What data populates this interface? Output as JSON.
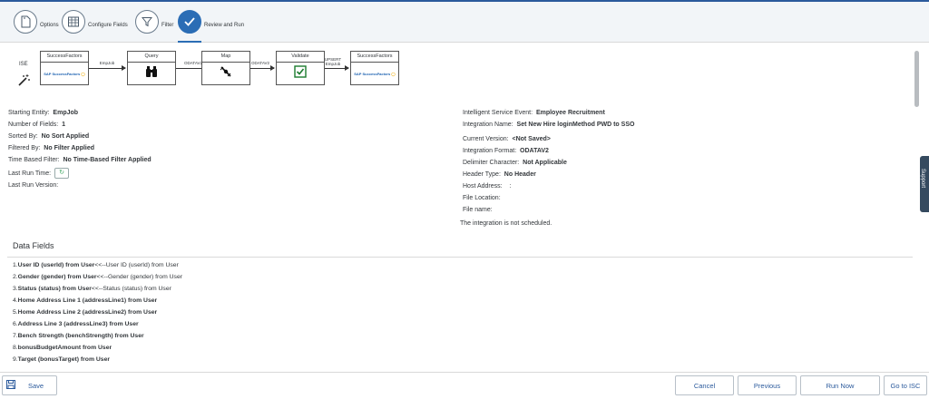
{
  "wizard": {
    "steps": [
      {
        "label": "Options",
        "icon": "document-icon"
      },
      {
        "label": "Configure Fields",
        "icon": "grid-icon"
      },
      {
        "label": "Filter",
        "icon": "filter-icon"
      },
      {
        "label": "Review and Run",
        "icon": "checkmark-icon"
      }
    ]
  },
  "flow": {
    "start_label": "ISE",
    "boxes": [
      {
        "title": "SuccessFactors",
        "content": "SAP SuccessFactors"
      },
      {
        "title": "Query"
      },
      {
        "title": "Map"
      },
      {
        "title": "Validate"
      },
      {
        "title": "SuccessFactors",
        "content": "SAP SuccessFactors"
      }
    ],
    "arrows": [
      "EmpJob",
      "ODATAV2",
      "ODATAV2",
      "UPSERT EmpJob"
    ]
  },
  "left_info": [
    {
      "label": "Starting Entity:",
      "value": "EmpJob"
    },
    {
      "label": "Number of Fields:",
      "value": "1"
    },
    {
      "label": "Sorted By:",
      "value": "No Sort Applied"
    },
    {
      "label": "Filtered By:",
      "value": "No Filter Applied"
    },
    {
      "label": "Time Based Filter:",
      "value": "No Time-Based Filter Applied"
    },
    {
      "label": "Last Run Time:",
      "value": ""
    },
    {
      "label": "Last Run Version:",
      "value": ""
    }
  ],
  "right_info": [
    {
      "label": "Intelligent Service Event:",
      "value": "Employee Recruitment"
    },
    {
      "label": "Integration Name:",
      "value": "Set New Hire loginMethod PWD to SSO"
    },
    {
      "label": "Current Version:",
      "value": "<Not Saved>"
    },
    {
      "label": "Integration Format:",
      "value": "ODATAV2"
    },
    {
      "label": "Delimiter Character:",
      "value": "Not Applicable"
    },
    {
      "label": "Header Type:",
      "value": "No Header"
    },
    {
      "label": "Host Address:",
      "value": ":"
    },
    {
      "label": "File Location:",
      "value": ""
    },
    {
      "label": "File name:",
      "value": ""
    }
  ],
  "schedule_note": "The integration is not scheduled.",
  "data_fields": {
    "title": "Data Fields",
    "rows": [
      {
        "num": "1.",
        "bold": "User ID (userId) from User",
        "rest": "<<--User ID (userId) from User"
      },
      {
        "num": "2.",
        "bold": "Gender (gender) from User",
        "rest": "<<--Gender (gender) from User"
      },
      {
        "num": "3.",
        "bold": "Status (status) from User",
        "rest": "<<--Status (status) from User"
      },
      {
        "num": "4.",
        "bold": "Home Address Line 1 (addressLine1) from User",
        "rest": ""
      },
      {
        "num": "5.",
        "bold": "Home Address Line 2 (addressLine2) from User",
        "rest": ""
      },
      {
        "num": "6.",
        "bold": "Address Line 3 (addressLine3) from User",
        "rest": ""
      },
      {
        "num": "7.",
        "bold": "Bench Strength (benchStrength) from User",
        "rest": ""
      },
      {
        "num": "8.",
        "bold": "bonusBudgetAmount from User",
        "rest": ""
      },
      {
        "num": "9.",
        "bold": "Target (bonusTarget) from User",
        "rest": ""
      }
    ]
  },
  "support_label": "Support",
  "footer": {
    "save": "Save",
    "cancel": "Cancel",
    "previous": "Previous",
    "run_now": "Run Now",
    "go_to_isc": "Go to ISC"
  },
  "colors": {
    "accent": "#2b6db5",
    "brand": "#1d62b1"
  }
}
